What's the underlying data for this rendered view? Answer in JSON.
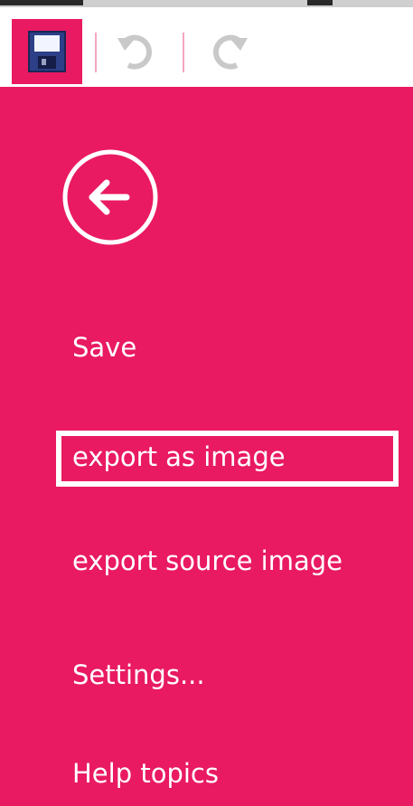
{
  "toolbar": {
    "save_icon": "floppy-disk-icon",
    "undo_icon": "undo-icon",
    "redo_icon": "redo-icon",
    "accent": "#e91a62"
  },
  "menu": {
    "back_icon": "back-arrow-icon",
    "items": [
      {
        "label": "Save"
      },
      {
        "label": "export as image",
        "selected": true
      },
      {
        "label": "export source image"
      },
      {
        "label": "Settings..."
      },
      {
        "label": "Help topics"
      }
    ]
  }
}
